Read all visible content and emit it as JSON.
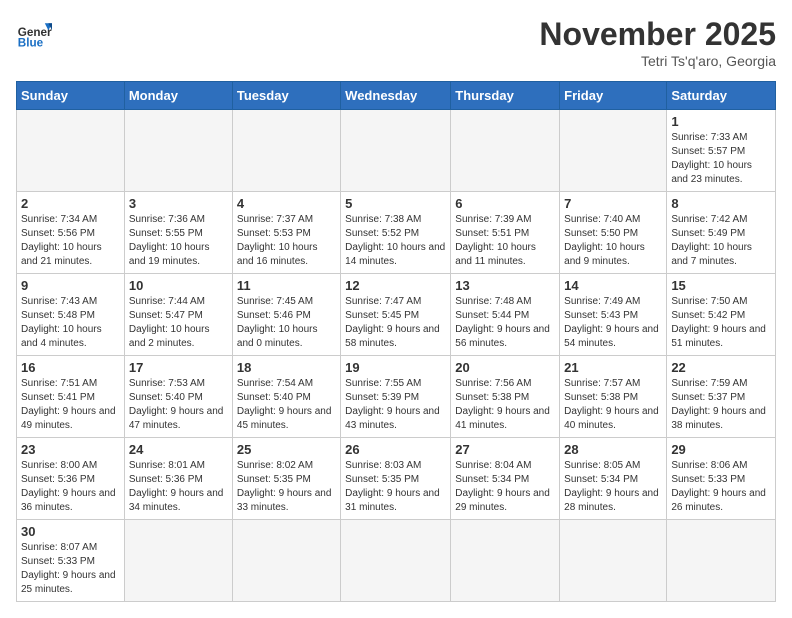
{
  "logo": {
    "general": "General",
    "blue": "Blue"
  },
  "header": {
    "month": "November 2025",
    "location": "Tetri Ts'q'aro, Georgia"
  },
  "weekdays": [
    "Sunday",
    "Monday",
    "Tuesday",
    "Wednesday",
    "Thursday",
    "Friday",
    "Saturday"
  ],
  "weeks": [
    [
      {
        "day": "",
        "info": ""
      },
      {
        "day": "",
        "info": ""
      },
      {
        "day": "",
        "info": ""
      },
      {
        "day": "",
        "info": ""
      },
      {
        "day": "",
        "info": ""
      },
      {
        "day": "",
        "info": ""
      },
      {
        "day": "1",
        "info": "Sunrise: 7:33 AM\nSunset: 5:57 PM\nDaylight: 10 hours and 23 minutes."
      }
    ],
    [
      {
        "day": "2",
        "info": "Sunrise: 7:34 AM\nSunset: 5:56 PM\nDaylight: 10 hours and 21 minutes."
      },
      {
        "day": "3",
        "info": "Sunrise: 7:36 AM\nSunset: 5:55 PM\nDaylight: 10 hours and 19 minutes."
      },
      {
        "day": "4",
        "info": "Sunrise: 7:37 AM\nSunset: 5:53 PM\nDaylight: 10 hours and 16 minutes."
      },
      {
        "day": "5",
        "info": "Sunrise: 7:38 AM\nSunset: 5:52 PM\nDaylight: 10 hours and 14 minutes."
      },
      {
        "day": "6",
        "info": "Sunrise: 7:39 AM\nSunset: 5:51 PM\nDaylight: 10 hours and 11 minutes."
      },
      {
        "day": "7",
        "info": "Sunrise: 7:40 AM\nSunset: 5:50 PM\nDaylight: 10 hours and 9 minutes."
      },
      {
        "day": "8",
        "info": "Sunrise: 7:42 AM\nSunset: 5:49 PM\nDaylight: 10 hours and 7 minutes."
      }
    ],
    [
      {
        "day": "9",
        "info": "Sunrise: 7:43 AM\nSunset: 5:48 PM\nDaylight: 10 hours and 4 minutes."
      },
      {
        "day": "10",
        "info": "Sunrise: 7:44 AM\nSunset: 5:47 PM\nDaylight: 10 hours and 2 minutes."
      },
      {
        "day": "11",
        "info": "Sunrise: 7:45 AM\nSunset: 5:46 PM\nDaylight: 10 hours and 0 minutes."
      },
      {
        "day": "12",
        "info": "Sunrise: 7:47 AM\nSunset: 5:45 PM\nDaylight: 9 hours and 58 minutes."
      },
      {
        "day": "13",
        "info": "Sunrise: 7:48 AM\nSunset: 5:44 PM\nDaylight: 9 hours and 56 minutes."
      },
      {
        "day": "14",
        "info": "Sunrise: 7:49 AM\nSunset: 5:43 PM\nDaylight: 9 hours and 54 minutes."
      },
      {
        "day": "15",
        "info": "Sunrise: 7:50 AM\nSunset: 5:42 PM\nDaylight: 9 hours and 51 minutes."
      }
    ],
    [
      {
        "day": "16",
        "info": "Sunrise: 7:51 AM\nSunset: 5:41 PM\nDaylight: 9 hours and 49 minutes."
      },
      {
        "day": "17",
        "info": "Sunrise: 7:53 AM\nSunset: 5:40 PM\nDaylight: 9 hours and 47 minutes."
      },
      {
        "day": "18",
        "info": "Sunrise: 7:54 AM\nSunset: 5:40 PM\nDaylight: 9 hours and 45 minutes."
      },
      {
        "day": "19",
        "info": "Sunrise: 7:55 AM\nSunset: 5:39 PM\nDaylight: 9 hours and 43 minutes."
      },
      {
        "day": "20",
        "info": "Sunrise: 7:56 AM\nSunset: 5:38 PM\nDaylight: 9 hours and 41 minutes."
      },
      {
        "day": "21",
        "info": "Sunrise: 7:57 AM\nSunset: 5:38 PM\nDaylight: 9 hours and 40 minutes."
      },
      {
        "day": "22",
        "info": "Sunrise: 7:59 AM\nSunset: 5:37 PM\nDaylight: 9 hours and 38 minutes."
      }
    ],
    [
      {
        "day": "23",
        "info": "Sunrise: 8:00 AM\nSunset: 5:36 PM\nDaylight: 9 hours and 36 minutes."
      },
      {
        "day": "24",
        "info": "Sunrise: 8:01 AM\nSunset: 5:36 PM\nDaylight: 9 hours and 34 minutes."
      },
      {
        "day": "25",
        "info": "Sunrise: 8:02 AM\nSunset: 5:35 PM\nDaylight: 9 hours and 33 minutes."
      },
      {
        "day": "26",
        "info": "Sunrise: 8:03 AM\nSunset: 5:35 PM\nDaylight: 9 hours and 31 minutes."
      },
      {
        "day": "27",
        "info": "Sunrise: 8:04 AM\nSunset: 5:34 PM\nDaylight: 9 hours and 29 minutes."
      },
      {
        "day": "28",
        "info": "Sunrise: 8:05 AM\nSunset: 5:34 PM\nDaylight: 9 hours and 28 minutes."
      },
      {
        "day": "29",
        "info": "Sunrise: 8:06 AM\nSunset: 5:33 PM\nDaylight: 9 hours and 26 minutes."
      }
    ],
    [
      {
        "day": "30",
        "info": "Sunrise: 8:07 AM\nSunset: 5:33 PM\nDaylight: 9 hours and 25 minutes."
      },
      {
        "day": "",
        "info": ""
      },
      {
        "day": "",
        "info": ""
      },
      {
        "day": "",
        "info": ""
      },
      {
        "day": "",
        "info": ""
      },
      {
        "day": "",
        "info": ""
      },
      {
        "day": "",
        "info": ""
      }
    ]
  ]
}
